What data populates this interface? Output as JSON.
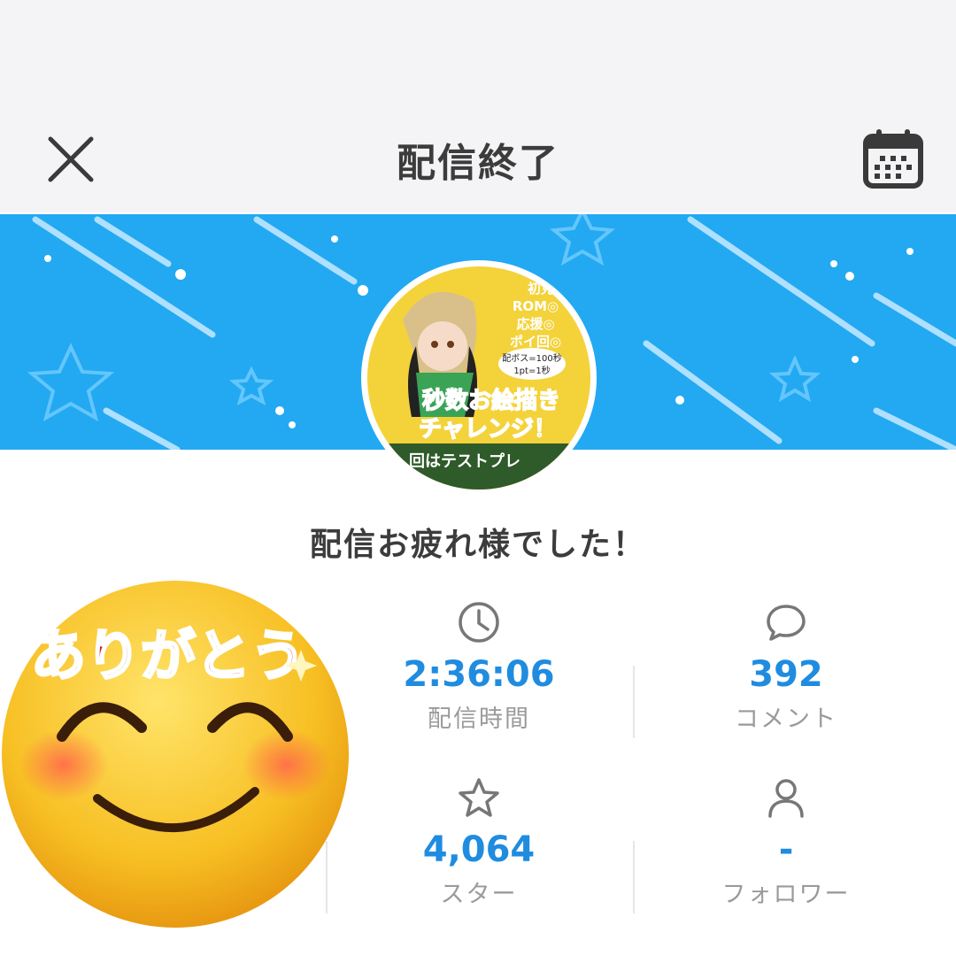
{
  "header": {
    "title": "配信終了",
    "close_icon": "close-icon",
    "calendar_icon": "calendar-icon"
  },
  "avatar": {
    "lines": [
      "初見",
      "ROM◎",
      "応援◎",
      "ポイ回◎",
      "配ボス=100秒",
      "1pt=1秒",
      "秒数お絵描き",
      "チャレンジ！",
      "回はテストプレ"
    ]
  },
  "message": "配信お疲れ様でした！",
  "stats": {
    "duration": {
      "value": "2:36:06",
      "label": "配信時間",
      "icon": "clock-icon"
    },
    "comments": {
      "value": "392",
      "label": "コメント",
      "icon": "comment-icon"
    },
    "stars": {
      "value": "4,064",
      "label": "スター",
      "icon": "star-icon"
    },
    "followers": {
      "value": "-",
      "label": "フォロワー",
      "icon": "person-icon"
    }
  },
  "sticker": {
    "text": "ありがとう"
  },
  "colors": {
    "banner": "#22a9f2",
    "accent": "#1f8ce0",
    "label": "#9a9a9a"
  }
}
